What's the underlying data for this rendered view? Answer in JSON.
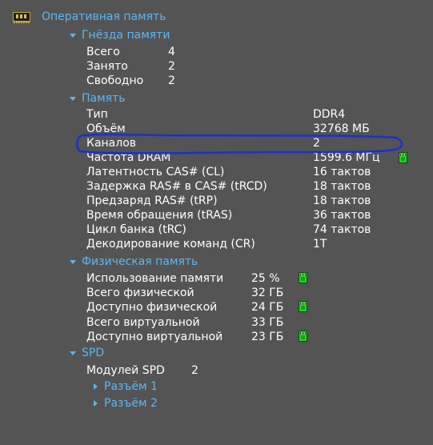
{
  "root": {
    "label": "Оперативная память",
    "icon": "ram-module-icon"
  },
  "slots": {
    "header": "Гнёзда памяти",
    "rows": [
      {
        "label": "Всего",
        "value": "4"
      },
      {
        "label": "Занято",
        "value": "2"
      },
      {
        "label": "Свободно",
        "value": "2"
      }
    ]
  },
  "memory": {
    "header": "Память",
    "rows": [
      {
        "label": "Тип",
        "value": "DDR4"
      },
      {
        "label": "Объём",
        "value": "32768 МБ"
      },
      {
        "label": "Каналов",
        "value": "2"
      },
      {
        "label": "Частота DRAM",
        "value": "1599.6 МГц"
      },
      {
        "label": "Латентность CAS# (CL)",
        "value": "16 тактов"
      },
      {
        "label": "Задержка RAS# в CAS# (tRCD)",
        "value": "18 тактов"
      },
      {
        "label": "Предзаряд RAS# (tRP)",
        "value": "18 тактов"
      },
      {
        "label": "Время обращения (tRAS)",
        "value": "36 тактов"
      },
      {
        "label": "Цикл банка (tRC)",
        "value": "74 тактов"
      },
      {
        "label": "Декодирование команд (CR)",
        "value": "1T"
      }
    ]
  },
  "physical": {
    "header": "Физическая память",
    "rows": [
      {
        "label": "Использование памяти",
        "value": "25 %"
      },
      {
        "label": "Всего физической",
        "value": "32 ГБ"
      },
      {
        "label": "Доступно физической",
        "value": "24 ГБ"
      },
      {
        "label": "Всего виртуальной",
        "value": "33 ГБ"
      },
      {
        "label": "Доступно виртуальной",
        "value": "23 ГБ"
      }
    ]
  },
  "spd": {
    "header": "SPD",
    "modules_label": "Модулей SPD",
    "modules_value": "2",
    "slots": [
      "Разъём 1",
      "Разъём 2"
    ]
  },
  "colors": {
    "background": "#545454",
    "category": "#5db7f2",
    "text": "#ffffff",
    "highlight_stroke": "#1c2fd0",
    "chip": "#27d62a"
  },
  "icons": {
    "expanded": "triangle-down-icon",
    "collapsed": "triangle-right-icon",
    "value_indicator": "memory-chip-icon"
  }
}
